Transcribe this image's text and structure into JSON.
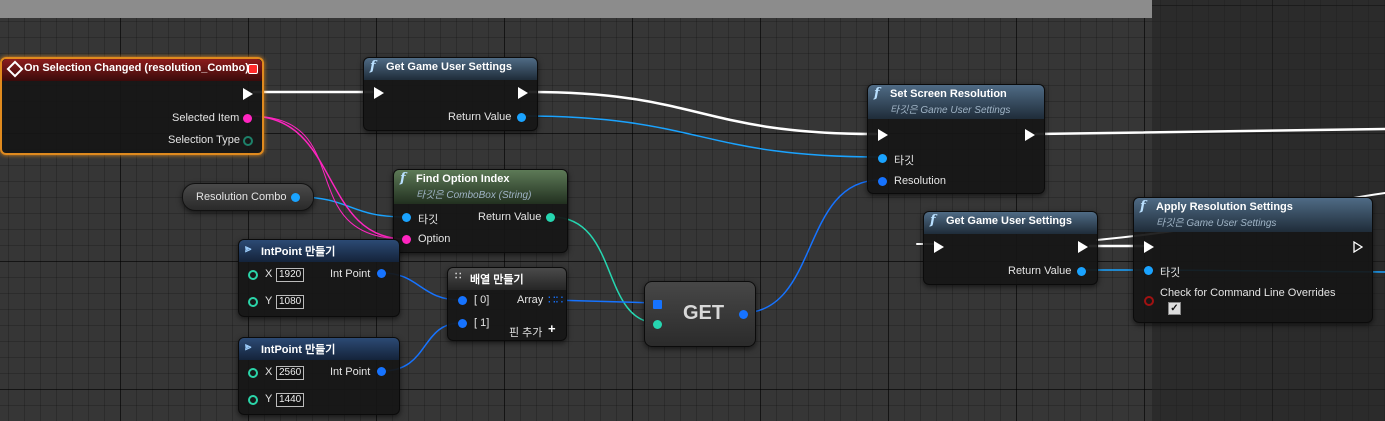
{
  "nodes": {
    "event": {
      "title": "On Selection Changed (resolution_Combo)",
      "selected_item": "Selected Item",
      "selection_type": "Selection Type"
    },
    "get_gus1": {
      "title": "Get Game User Settings",
      "return_value": "Return Value"
    },
    "set_res": {
      "title": "Set Screen Resolution",
      "subtitle": "타깃은 Game User Settings",
      "target": "타깃",
      "resolution": "Resolution"
    },
    "resolution_combo": {
      "label": "Resolution Combo"
    },
    "find_option": {
      "title": "Find Option Index",
      "subtitle": "타깃은 ComboBox (String)",
      "target": "타깃",
      "option": "Option",
      "return_value": "Return Value"
    },
    "intpoint1": {
      "title": "IntPoint 만들기",
      "x_label": "X",
      "y_label": "Y",
      "x": "1920",
      "y": "1080",
      "out": "Int Point"
    },
    "intpoint2": {
      "title": "IntPoint 만들기",
      "x_label": "X",
      "y_label": "Y",
      "x": "2560",
      "y": "1440",
      "out": "Int Point"
    },
    "make_array": {
      "title": "배열 만들기",
      "in0": "[ 0]",
      "in1": "[ 1]",
      "out": "Array",
      "add_pin": "핀 추가"
    },
    "get": {
      "label": "GET"
    },
    "get_gus2": {
      "title": "Get Game User Settings",
      "return_value": "Return Value"
    },
    "apply": {
      "title": "Apply Resolution Settings",
      "subtitle": "타깃은 Game User Settings",
      "target": "타깃",
      "check": "Check for Command Line Overrides"
    }
  },
  "icons": [
    "function-icon",
    "event-icon",
    "make-struct-icon",
    "array-grid-icon",
    "plus-icon",
    "checkmark-icon"
  ],
  "colors": {
    "canvas": "#363636",
    "exec_wire": "#ffffff",
    "object_pin": "#1aa3ff",
    "struct_pin": "#1673ff",
    "int_pin": "#26d6b0",
    "string_pin": "#ff25c0",
    "event_border": "#e08a1e"
  }
}
